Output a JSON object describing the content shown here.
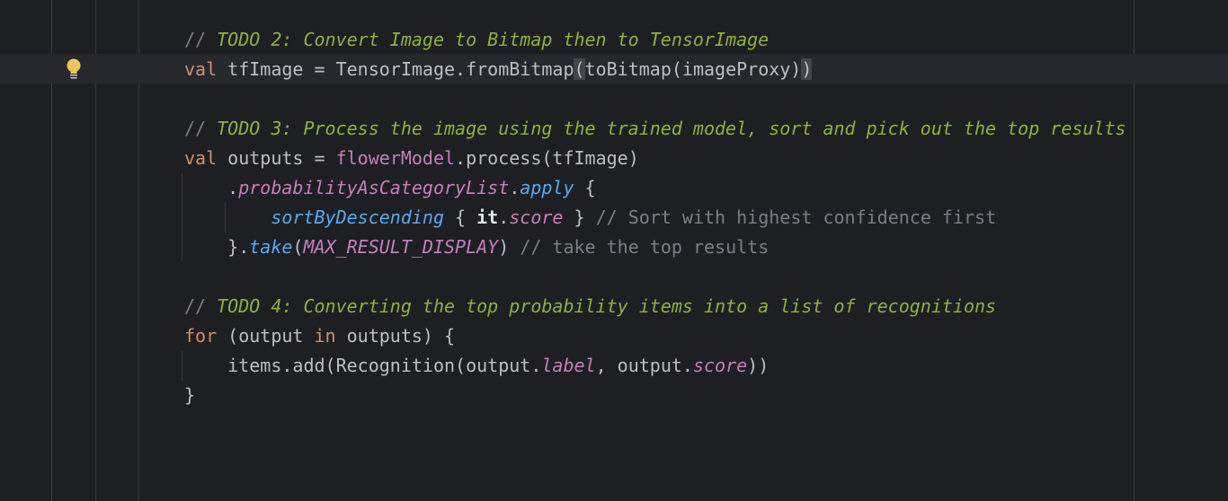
{
  "editor": {
    "colors": {
      "background": "#1e1f22",
      "keyword": "#cf8e6d",
      "comment": "#7a7e85",
      "todo": "#8bb33d",
      "property": "#c77dbb",
      "function": "#56a8f5",
      "text": "#bcbec4"
    },
    "gutter_icon": "lightbulb-icon",
    "current_line": 2,
    "lines": [
      [
        [
          "// ",
          "cm"
        ],
        [
          "TODO 2: Convert Image to Bitmap then to TensorImage",
          "todo"
        ]
      ],
      [
        [
          "val",
          "kw"
        ],
        [
          " tfImage = TensorImage.fromBitmap",
          "pl"
        ],
        [
          "(",
          "match"
        ],
        [
          "toBitmap(imageProxy)",
          "pl"
        ],
        [
          ")",
          "match"
        ]
      ],
      [],
      [
        [
          "// ",
          "cm"
        ],
        [
          "TODO 3: Process the image using the trained model, sort and pick out the top results",
          "todo"
        ]
      ],
      [
        [
          "val",
          "kw"
        ],
        [
          " outputs = ",
          "pl"
        ],
        [
          "flowerModel",
          "var"
        ],
        [
          ".process(tfImage)",
          "pl"
        ]
      ],
      [
        [
          "    .",
          "pl"
        ],
        [
          "probabilityAsCategoryList",
          "prop"
        ],
        [
          ".",
          "pl"
        ],
        [
          "apply",
          "fn"
        ],
        [
          " {",
          "pl"
        ]
      ],
      [
        [
          "        ",
          "pl"
        ],
        [
          "sortByDescending",
          "fn"
        ],
        [
          " { ",
          "pl"
        ],
        [
          "it",
          "it"
        ],
        [
          ".",
          "pl"
        ],
        [
          "score",
          "prop"
        ],
        [
          " } ",
          "pl"
        ],
        [
          "// Sort with highest confidence first",
          "cm"
        ]
      ],
      [
        [
          "    }.",
          "pl"
        ],
        [
          "take",
          "fn"
        ],
        [
          "(",
          "pl"
        ],
        [
          "MAX_RESULT_DISPLAY",
          "const"
        ],
        [
          ") ",
          "pl"
        ],
        [
          "// take the top results",
          "cm"
        ]
      ],
      [],
      [
        [
          "// ",
          "cm"
        ],
        [
          "TODO 4: Converting the top probability items into a list of recognitions",
          "todo"
        ]
      ],
      [
        [
          "for",
          "kw"
        ],
        [
          " (output ",
          "pl"
        ],
        [
          "in",
          "kw"
        ],
        [
          " outputs) {",
          "pl"
        ]
      ],
      [
        [
          "    items.add(Recognition(output.",
          "pl"
        ],
        [
          "label",
          "prop"
        ],
        [
          ", output.",
          "pl"
        ],
        [
          "score",
          "prop"
        ],
        [
          "))",
          "pl"
        ]
      ],
      [
        [
          "}",
          "pl"
        ]
      ]
    ]
  }
}
